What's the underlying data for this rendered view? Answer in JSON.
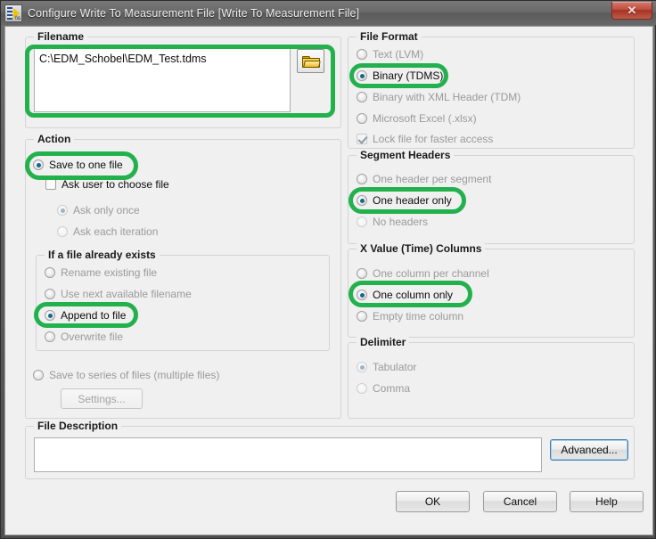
{
  "window": {
    "title": "Configure Write To Measurement File [Write To Measurement File]",
    "icon": "labview-vi-icon",
    "close_label": "✕"
  },
  "filename": {
    "legend": "Filename",
    "value": "C:\\EDM_Schobel\\EDM_Test.tdms",
    "browse_icon": "folder-open-icon"
  },
  "action": {
    "legend": "Action",
    "save_one_file": "Save to one file",
    "ask_user": "Ask user to choose file",
    "ask_once": "Ask only once",
    "ask_each": "Ask each iteration",
    "exists": {
      "legend": "If a file already exists",
      "rename": "Rename existing file",
      "next_available": "Use next available filename",
      "append": "Append to file",
      "overwrite": "Overwrite file"
    },
    "save_series": "Save to series of files (multiple files)",
    "settings_button": "Settings..."
  },
  "file_format": {
    "legend": "File Format",
    "text_lvm": "Text (LVM)",
    "binary_tdms": "Binary (TDMS)",
    "binary_xml_tdm": "Binary with XML Header (TDM)",
    "excel_xlsx": "Microsoft Excel (.xlsx)",
    "lock_file": "Lock file for faster access"
  },
  "segment_headers": {
    "legend": "Segment Headers",
    "per_segment": "One header per segment",
    "one_only": "One header only",
    "none": "No headers"
  },
  "x_value_columns": {
    "legend": "X Value (Time) Columns",
    "per_channel": "One column per channel",
    "one_only": "One column only",
    "empty": "Empty time column"
  },
  "delimiter": {
    "legend": "Delimiter",
    "tabulator": "Tabulator",
    "comma": "Comma"
  },
  "file_description": {
    "legend": "File Description",
    "value": "",
    "advanced_button": "Advanced..."
  },
  "footer": {
    "ok": "OK",
    "cancel": "Cancel",
    "help": "Help"
  },
  "annotations": {
    "color": "#22b14c",
    "targets": [
      "filename-textbox",
      "radio-save-to-one-file",
      "radio-append-to-file",
      "radio-binary-tdms",
      "radio-one-header-only",
      "radio-one-column-only"
    ]
  }
}
